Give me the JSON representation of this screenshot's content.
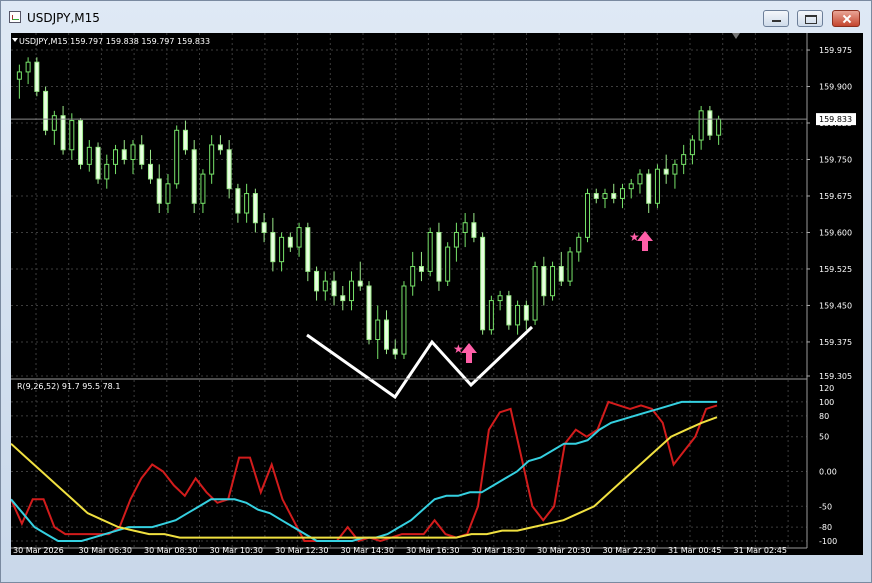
{
  "window": {
    "title": "USDJPY,M15"
  },
  "main_panel": {
    "label": "USDJPY,M15  159.797 159.838 159.797 159.833",
    "price_axis": [
      "159.975",
      "159.900",
      "159.825",
      "159.750",
      "159.675",
      "159.600",
      "159.525",
      "159.450",
      "159.375",
      "159.305"
    ],
    "current_price": "159.833"
  },
  "indicator_panel": {
    "label": "R(9,26,52) 91.7 95.5 78.1",
    "axis": [
      "120",
      "100",
      "80",
      "50",
      "0.00",
      "-50",
      "-80",
      "-100"
    ]
  },
  "time_axis": [
    "30 Mar 2026",
    "30 Mar 06:30",
    "30 Mar 08:30",
    "30 Mar 10:30",
    "30 Mar 12:30",
    "30 Mar 14:30",
    "30 Mar 16:30",
    "30 Mar 18:30",
    "30 Mar 20:30",
    "30 Mar 22:30",
    "31 Mar 00:45",
    "31 Mar 02:45"
  ],
  "colors": {
    "bull": "#77e36a",
    "bear": "#9be88a",
    "line_red": "#d21c1c",
    "line_cyan": "#35d0e0",
    "line_yellow": "#f0e040",
    "signal": "#ff5fa8",
    "grid": "#3d3d3d",
    "pattern": "#ffffff"
  },
  "chart_data": [
    {
      "type": "candlestick",
      "title": "USDJPY,M15",
      "ylim": [
        159.305,
        160.01
      ],
      "y_ticks": [
        159.975,
        159.9,
        159.825,
        159.75,
        159.675,
        159.6,
        159.525,
        159.45,
        159.375,
        159.305
      ],
      "current_price": 159.833,
      "candles_ohlc": [
        [
          159.915,
          159.945,
          159.875,
          159.93
        ],
        [
          159.93,
          159.96,
          159.905,
          159.95
        ],
        [
          159.95,
          159.96,
          159.88,
          159.89
        ],
        [
          159.89,
          159.9,
          159.8,
          159.81
        ],
        [
          159.81,
          159.85,
          159.78,
          159.84
        ],
        [
          159.84,
          159.86,
          159.76,
          159.77
        ],
        [
          159.77,
          159.845,
          159.75,
          159.83
        ],
        [
          159.83,
          159.835,
          159.73,
          159.74
        ],
        [
          159.74,
          159.79,
          159.725,
          159.775
        ],
        [
          159.775,
          159.785,
          159.7,
          159.71
        ],
        [
          159.71,
          159.76,
          159.69,
          159.74
        ],
        [
          159.74,
          159.78,
          159.72,
          159.77
        ],
        [
          159.77,
          159.79,
          159.74,
          159.75
        ],
        [
          159.75,
          159.79,
          159.72,
          159.78
        ],
        [
          159.78,
          159.8,
          159.73,
          159.74
        ],
        [
          159.74,
          159.77,
          159.7,
          159.71
        ],
        [
          159.71,
          159.74,
          159.64,
          159.66
        ],
        [
          159.66,
          159.72,
          159.64,
          159.7
        ],
        [
          159.7,
          159.82,
          159.69,
          159.81
        ],
        [
          159.81,
          159.83,
          159.76,
          159.77
        ],
        [
          159.77,
          159.79,
          159.64,
          159.66
        ],
        [
          159.66,
          159.73,
          159.64,
          159.72
        ],
        [
          159.72,
          159.8,
          159.7,
          159.78
        ],
        [
          159.78,
          159.8,
          159.76,
          159.77
        ],
        [
          159.77,
          159.79,
          159.67,
          159.69
        ],
        [
          159.69,
          159.7,
          159.62,
          159.64
        ],
        [
          159.64,
          159.7,
          159.62,
          159.68
        ],
        [
          159.68,
          159.69,
          159.6,
          159.62
        ],
        [
          159.62,
          159.64,
          159.58,
          159.6
        ],
        [
          159.6,
          159.63,
          159.52,
          159.54
        ],
        [
          159.54,
          159.6,
          159.52,
          159.59
        ],
        [
          159.59,
          159.6,
          159.56,
          159.57
        ],
        [
          159.57,
          159.62,
          159.55,
          159.61
        ],
        [
          159.61,
          159.62,
          159.5,
          159.52
        ],
        [
          159.52,
          159.53,
          159.46,
          159.48
        ],
        [
          159.48,
          159.52,
          159.46,
          159.5
        ],
        [
          159.5,
          159.52,
          159.45,
          159.47
        ],
        [
          159.47,
          159.49,
          159.44,
          159.46
        ],
        [
          159.46,
          159.52,
          159.44,
          159.5
        ],
        [
          159.5,
          159.54,
          159.48,
          159.49
        ],
        [
          159.49,
          159.5,
          159.37,
          159.38
        ],
        [
          159.38,
          159.45,
          159.34,
          159.42
        ],
        [
          159.42,
          159.44,
          159.35,
          159.36
        ],
        [
          159.36,
          159.38,
          159.34,
          159.35
        ],
        [
          159.35,
          159.5,
          159.34,
          159.49
        ],
        [
          159.49,
          159.56,
          159.47,
          159.53
        ],
        [
          159.53,
          159.56,
          159.5,
          159.52
        ],
        [
          159.52,
          159.61,
          159.51,
          159.6
        ],
        [
          159.6,
          159.62,
          159.48,
          159.5
        ],
        [
          159.5,
          159.58,
          159.49,
          159.57
        ],
        [
          159.57,
          159.62,
          159.54,
          159.6
        ],
        [
          159.6,
          159.64,
          159.57,
          159.62
        ],
        [
          159.62,
          159.64,
          159.58,
          159.59
        ],
        [
          159.59,
          159.6,
          159.39,
          159.4
        ],
        [
          159.4,
          159.47,
          159.39,
          159.46
        ],
        [
          159.46,
          159.48,
          159.44,
          159.47
        ],
        [
          159.47,
          159.48,
          159.4,
          159.41
        ],
        [
          159.41,
          159.46,
          159.39,
          159.45
        ],
        [
          159.45,
          159.46,
          159.4,
          159.42
        ],
        [
          159.42,
          159.54,
          159.41,
          159.53
        ],
        [
          159.53,
          159.55,
          159.45,
          159.47
        ],
        [
          159.47,
          159.54,
          159.46,
          159.53
        ],
        [
          159.53,
          159.56,
          159.49,
          159.5
        ],
        [
          159.5,
          159.57,
          159.49,
          159.56
        ],
        [
          159.56,
          159.6,
          159.54,
          159.59
        ],
        [
          159.59,
          159.69,
          159.58,
          159.68
        ],
        [
          159.68,
          159.69,
          159.66,
          159.67
        ],
        [
          159.67,
          159.69,
          159.65,
          159.68
        ],
        [
          159.68,
          159.7,
          159.66,
          159.67
        ],
        [
          159.67,
          159.7,
          159.65,
          159.69
        ],
        [
          159.69,
          159.71,
          159.67,
          159.7
        ],
        [
          159.7,
          159.73,
          159.68,
          159.72
        ],
        [
          159.72,
          159.73,
          159.64,
          159.66
        ],
        [
          159.66,
          159.74,
          159.65,
          159.73
        ],
        [
          159.73,
          159.76,
          159.7,
          159.72
        ],
        [
          159.72,
          159.75,
          159.69,
          159.74
        ],
        [
          159.74,
          159.78,
          159.72,
          159.76
        ],
        [
          159.76,
          159.8,
          159.74,
          159.79
        ],
        [
          159.79,
          159.86,
          159.77,
          159.85
        ],
        [
          159.85,
          159.86,
          159.79,
          159.8
        ],
        [
          159.8,
          159.84,
          159.78,
          159.833
        ]
      ]
    },
    {
      "type": "line",
      "title": "R(9,26,52)",
      "ylim": [
        -110,
        120
      ],
      "y_ticks": [
        100,
        80,
        50,
        0,
        -50,
        -80,
        -100
      ],
      "series": [
        {
          "name": "R(9)",
          "values": [
            -40,
            -75,
            -40,
            -40,
            -80,
            -90,
            -90,
            -90,
            -90,
            -90,
            -80,
            -40,
            -10,
            10,
            0,
            -20,
            -35,
            -10,
            -30,
            -45,
            -40,
            20,
            20,
            -30,
            10,
            -40,
            -70,
            -100,
            -100,
            -100,
            -100,
            -80,
            -100,
            -95,
            -100,
            -95,
            -90,
            -90,
            -90,
            -70,
            -90,
            -95,
            -90,
            -50,
            60,
            85,
            90,
            20,
            -50,
            -70,
            -50,
            40,
            60,
            50,
            60,
            100,
            95,
            90,
            95,
            90,
            70,
            10,
            30,
            50,
            90,
            95
          ]
        },
        {
          "name": "R(26)",
          "values": [
            -40,
            -60,
            -80,
            -90,
            -100,
            -100,
            -100,
            -95,
            -90,
            -85,
            -80,
            -80,
            -80,
            -75,
            -70,
            -60,
            -50,
            -40,
            -40,
            -40,
            -45,
            -55,
            -60,
            -70,
            -80,
            -90,
            -100,
            -100,
            -100,
            -100,
            -95,
            -95,
            -90,
            -80,
            -70,
            -55,
            -40,
            -35,
            -35,
            -30,
            -30,
            -20,
            -10,
            0,
            15,
            20,
            30,
            40,
            40,
            45,
            60,
            70,
            75,
            80,
            85,
            90,
            95,
            100,
            100,
            100,
            100
          ]
        },
        {
          "name": "R(52)",
          "values": [
            40,
            20,
            0,
            -20,
            -40,
            -60,
            -70,
            -80,
            -85,
            -90,
            -90,
            -95,
            -95,
            -95,
            -95,
            -95,
            -95,
            -95,
            -95,
            -95,
            -95,
            -95,
            -95,
            -95,
            -95,
            -95,
            -95,
            -95,
            -95,
            -95,
            -90,
            -90,
            -85,
            -85,
            -80,
            -75,
            -70,
            -60,
            -50,
            -30,
            -10,
            10,
            30,
            50,
            60,
            70,
            78
          ]
        }
      ]
    }
  ]
}
